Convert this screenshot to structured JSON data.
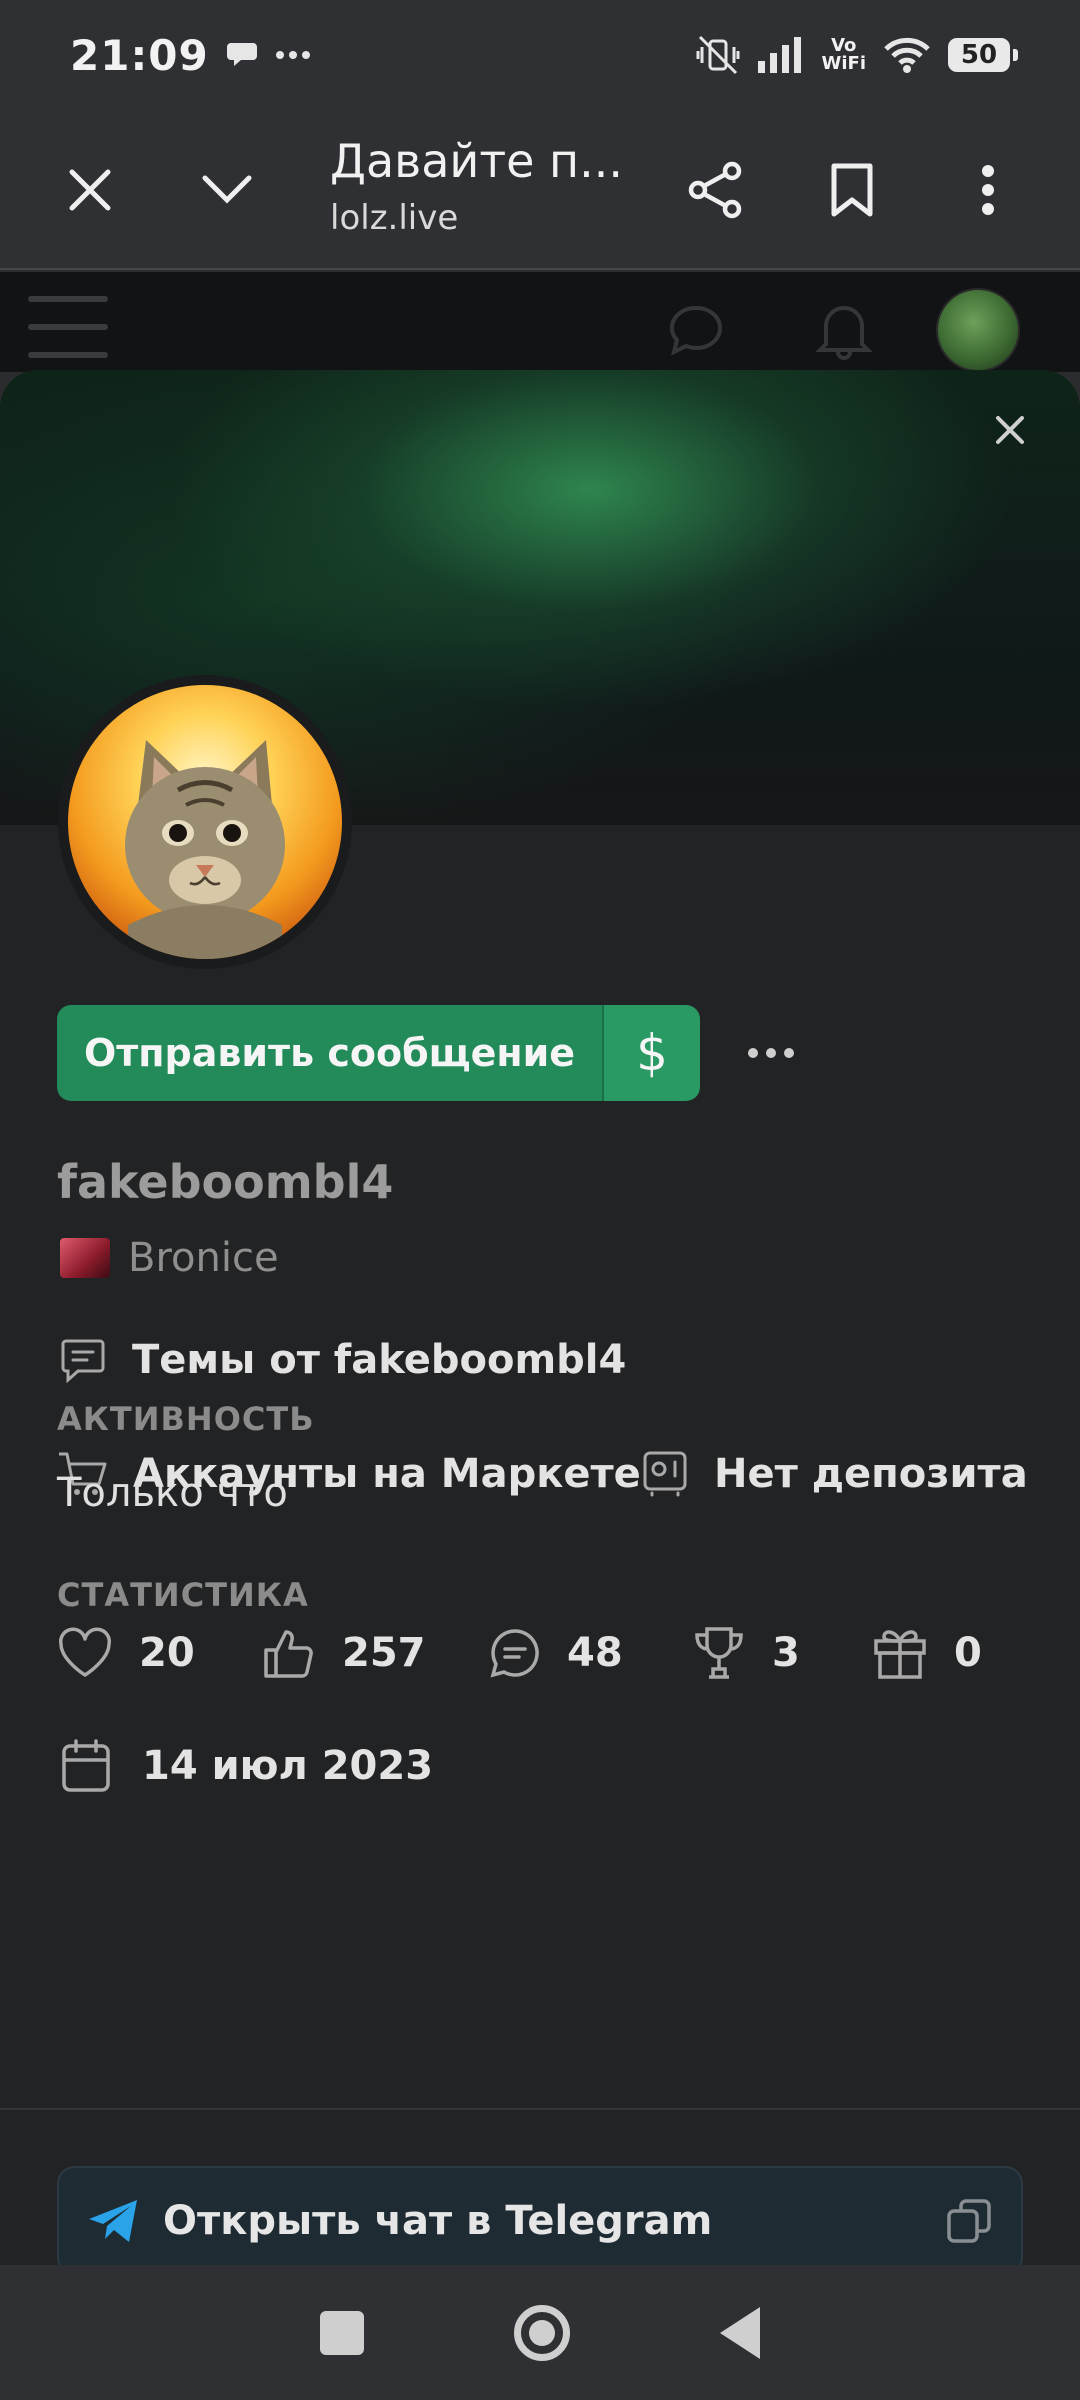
{
  "status_bar": {
    "time": "21:09",
    "vowifi_top": "Vo",
    "vowifi_bottom": "WiFi",
    "battery": "50"
  },
  "browser": {
    "title": "Давайте п...",
    "domain": "lolz.live"
  },
  "profile": {
    "send_message_label": "Отправить сообщение",
    "tip_symbol": "$",
    "username": "fakeboombl4",
    "rank": "Bronice",
    "threads_link": "Темы от fakeboombl4",
    "market_link": "Аккаунты на Маркете",
    "deposit_label": "Нет депозита",
    "activity_heading": "АКТИВНОСТЬ",
    "activity_value": "Только что",
    "stats_heading": "СТАТИСТИКА",
    "stats": {
      "likes": "20",
      "thumbs": "257",
      "messages": "48",
      "trophies": "3",
      "gifts": "0"
    },
    "registered": "14 июл 2023",
    "telegram_label": "Открыть чат в Telegram"
  },
  "colors": {
    "accent_green": "#238a5a",
    "card_bg": "#222324",
    "telegram_blue": "#2aa3e8"
  }
}
